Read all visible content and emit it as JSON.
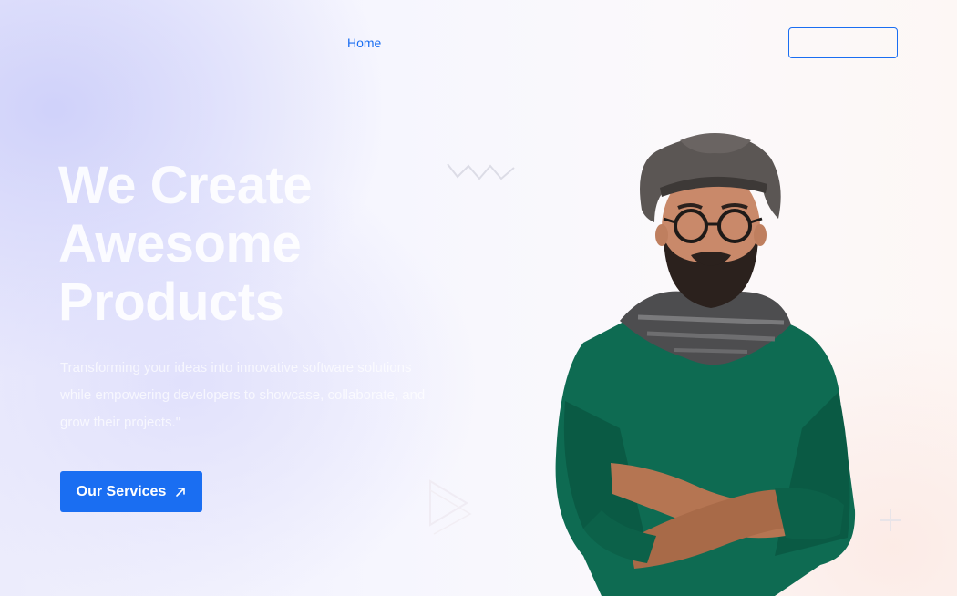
{
  "nav": {
    "home_label": "Home",
    "cta_label": ""
  },
  "hero": {
    "title": "We Create Awesome Products",
    "subtitle": "Transforming your ideas into innovative software solutions while empowering developers to showcase, collaborate, and grow their projects.\"",
    "cta_label": "Our Services",
    "cta_icon": "arrow-up-right-icon"
  },
  "decorations": {
    "zigzag": "zigzag-icon",
    "play": "play-outline-icon",
    "plus": "plus-icon"
  },
  "colors": {
    "accent": "#1a6ef2",
    "sweater": "#0e6b52",
    "hat": "#5b5654"
  }
}
